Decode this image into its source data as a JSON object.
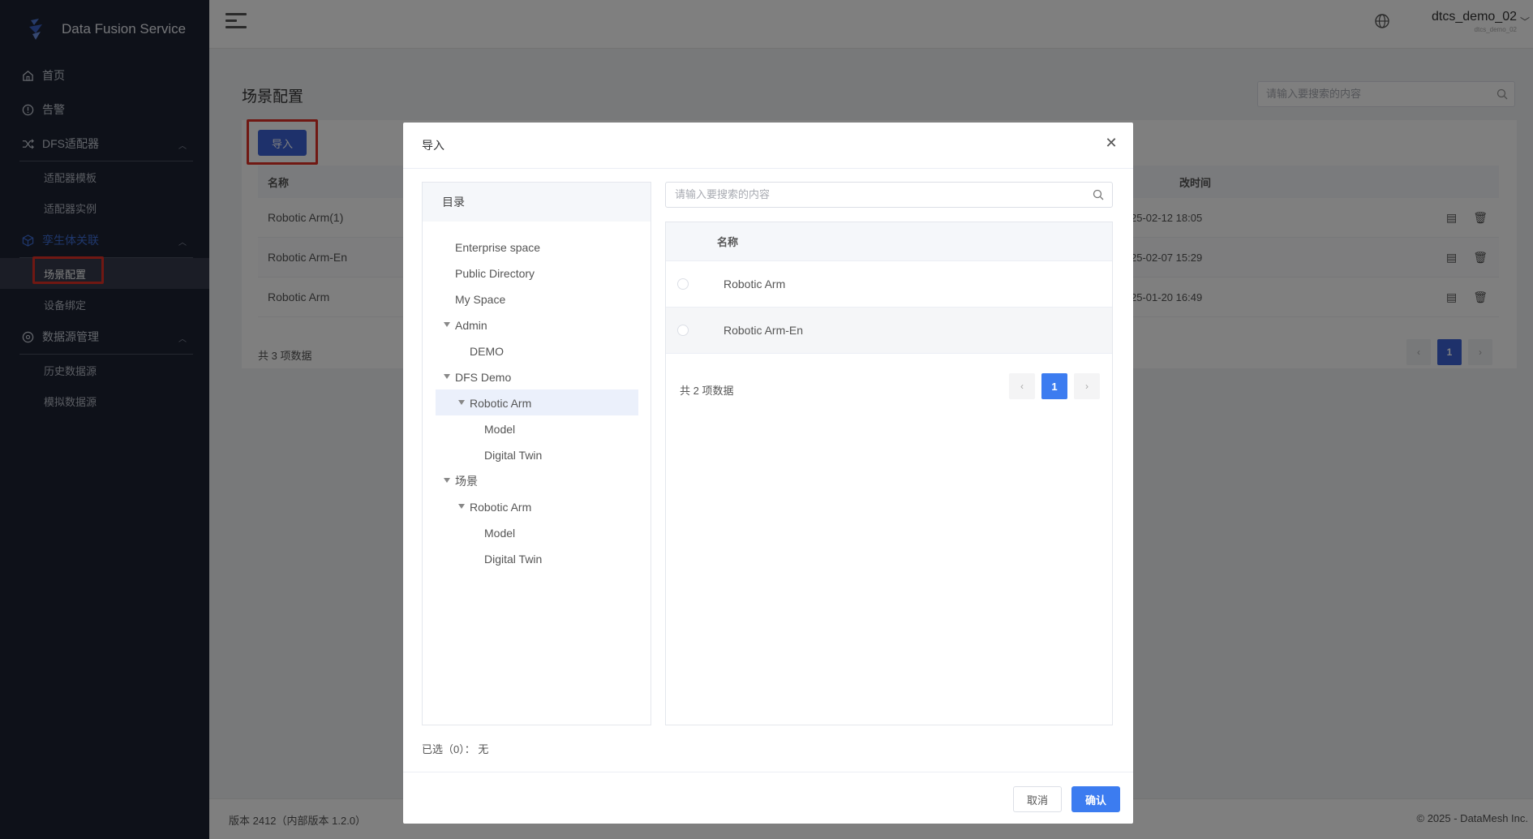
{
  "app": {
    "title": "Data Fusion Service"
  },
  "sidebar": {
    "items": [
      {
        "label": "首页",
        "icon": "home-icon"
      },
      {
        "label": "告警",
        "icon": "alert-icon"
      },
      {
        "label": "DFS适配器",
        "icon": "shuffle-icon",
        "children": [
          "适配器模板",
          "适配器实例"
        ]
      },
      {
        "label": "孪生体关联",
        "icon": "cube-icon",
        "children": [
          "场景配置",
          "设备绑定"
        ]
      },
      {
        "label": "数据源管理",
        "icon": "database-icon",
        "children": [
          "历史数据源",
          "模拟数据源"
        ]
      }
    ]
  },
  "topbar": {
    "user_name": "dtcs_demo_02",
    "user_sub": "dtcs_demo_02"
  },
  "page": {
    "title": "场景配置",
    "search_placeholder": "请输入要搜索的内容",
    "import_label": "导入",
    "table": {
      "col_name": "名称",
      "col_time": "改时间",
      "rows": [
        {
          "name": "Robotic Arm(1)",
          "time": "25-02-12 18:05"
        },
        {
          "name": "Robotic Arm-En",
          "time": "25-02-07 15:29"
        },
        {
          "name": "Robotic Arm",
          "time": "25-01-20 16:49"
        }
      ]
    },
    "total": "共 3 项数据",
    "page": "1"
  },
  "footer": {
    "version": "版本 2412（内部版本 1.2.0）",
    "copyright": "© 2025 - DataMesh Inc."
  },
  "modal": {
    "title": "导入",
    "tree_header": "目录",
    "tree": [
      {
        "label": "Enterprise space"
      },
      {
        "label": "Public Directory"
      },
      {
        "label": "My Space"
      },
      {
        "label": "Admin"
      },
      {
        "label": "DEMO"
      },
      {
        "label": "DFS Demo"
      },
      {
        "label": "Robotic Arm"
      },
      {
        "label": "Model"
      },
      {
        "label": "Digital Twin"
      },
      {
        "label": "场景"
      },
      {
        "label": "Robotic Arm"
      },
      {
        "label": "Model"
      },
      {
        "label": "Digital Twin"
      }
    ],
    "search_placeholder": "请输入要搜索的内容",
    "list_header": "名称",
    "list": [
      {
        "name": "Robotic Arm"
      },
      {
        "name": "Robotic Arm-En"
      }
    ],
    "total": "共 2 项数据",
    "page": "1",
    "selected": "已选（0）：  无",
    "cancel": "取消",
    "ok": "确认"
  }
}
